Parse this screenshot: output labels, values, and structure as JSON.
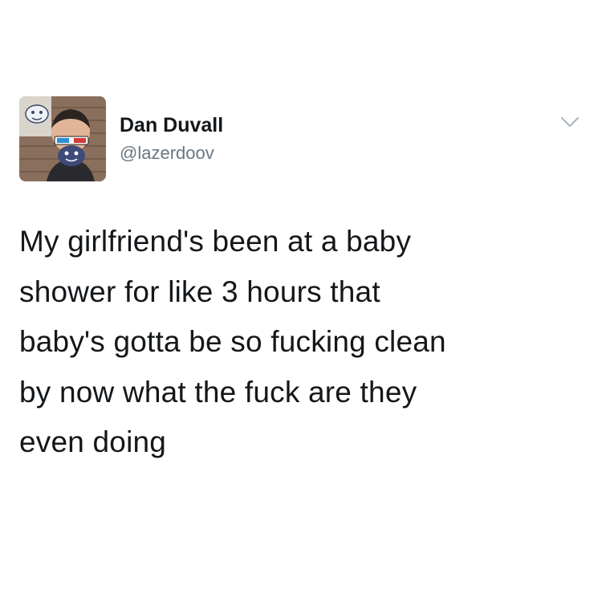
{
  "author": {
    "display_name": "Dan Duvall",
    "handle": "@lazerdoov",
    "avatar_icon": "profile-photo"
  },
  "menu": {
    "icon": "chevron-down-icon"
  },
  "tweet": {
    "text": "My girlfriend's been at a baby\nshower for like 3 hours that\nbaby's gotta be so fucking clean\nby now what the fuck are they\neven doing"
  },
  "colors": {
    "text": "#14171a",
    "handle": "#6b7680",
    "caret": "#aab8c2"
  }
}
